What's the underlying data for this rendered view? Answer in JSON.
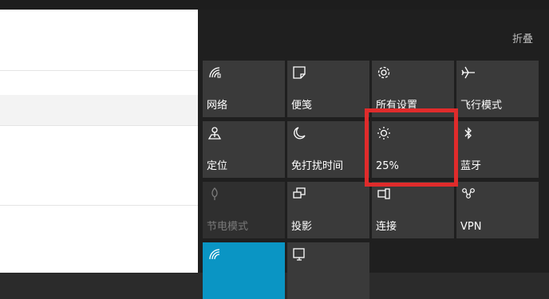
{
  "action_center": {
    "collapse_label": "折叠",
    "tiles": [
      {
        "label": "网络",
        "icon": "network-icon"
      },
      {
        "label": "便笺",
        "icon": "note-icon"
      },
      {
        "label": "所有设置",
        "icon": "gear-icon"
      },
      {
        "label": "飞行模式",
        "icon": "airplane-icon"
      },
      {
        "label": "定位",
        "icon": "location-icon"
      },
      {
        "label": "免打扰时间",
        "icon": "moon-icon"
      },
      {
        "label": "25%",
        "icon": "brightness-icon"
      },
      {
        "label": "蓝牙",
        "icon": "bluetooth-icon"
      },
      {
        "label": "节电模式",
        "icon": "battery-saver-icon"
      },
      {
        "label": "投影",
        "icon": "project-icon"
      },
      {
        "label": "连接",
        "icon": "connect-icon"
      },
      {
        "label": "VPN",
        "icon": "vpn-icon"
      }
    ]
  },
  "colors": {
    "tile": "#3a3a3a",
    "tile_disabled": "#2f2f2f",
    "wifi_active": "#0a95c4",
    "highlight": "#e02b2b",
    "panel": "#1f1f1f"
  }
}
